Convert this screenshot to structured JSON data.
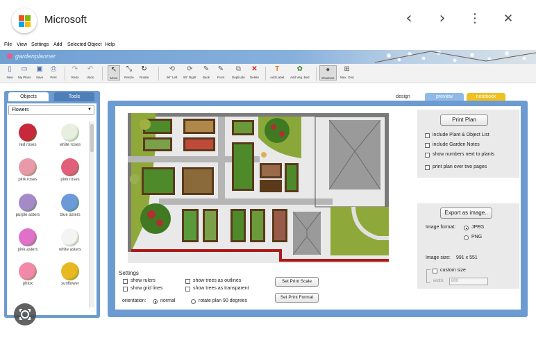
{
  "window": {
    "title": "Microsoft",
    "back_icon": "‹",
    "forward_icon": "›",
    "more_icon": "⋮",
    "close_icon": "✕"
  },
  "menu": [
    "File",
    "View",
    "Settings",
    "Add",
    "Selected Object",
    "Help"
  ],
  "brand": {
    "name": "gardenplanner"
  },
  "toolbar": [
    {
      "icon": "new-doc-icon",
      "label": "New"
    },
    {
      "icon": "folder-icon",
      "label": "My Plans"
    },
    {
      "icon": "save-icon",
      "label": "Save"
    },
    {
      "icon": "print-icon",
      "label": "Print"
    },
    {
      "icon": "redo-icon",
      "label": "Redo"
    },
    {
      "icon": "undo-icon",
      "label": "Undo"
    },
    {
      "icon": "cursor-icon",
      "label": "Move"
    },
    {
      "icon": "resize-icon",
      "label": "Resize"
    },
    {
      "icon": "rotate-icon",
      "label": "Rotate"
    },
    {
      "icon": "rotate-left-icon",
      "label": "90° Left"
    },
    {
      "icon": "rotate-right-icon",
      "label": "90° Right"
    },
    {
      "icon": "pen-icon",
      "label": "Back"
    },
    {
      "icon": "pen-front-icon",
      "label": "Front"
    },
    {
      "icon": "duplicate-icon",
      "label": "Duplicate"
    },
    {
      "icon": "delete-icon",
      "label": "Delete"
    },
    {
      "icon": "text-icon",
      "label": "Add Label"
    },
    {
      "icon": "veg-bed-icon",
      "label": "Add Veg. Bed"
    },
    {
      "icon": "shadow-icon",
      "label": "Shadows"
    },
    {
      "icon": "grid-icon",
      "label": "Max. Grid"
    }
  ],
  "left_panel": {
    "tabs": [
      "Objects",
      "Tools"
    ],
    "category": "Flowers",
    "plants": [
      {
        "name": "red roses",
        "color": "#c8283a"
      },
      {
        "name": "white roses",
        "color": "#e8efe0"
      },
      {
        "name": "pink roses",
        "color": "#e89aa8"
      },
      {
        "name": "pink roses",
        "color": "#e0607a"
      },
      {
        "name": "purple asters",
        "color": "#a58ac8"
      },
      {
        "name": "blue asters",
        "color": "#6c9ad8"
      },
      {
        "name": "pink asters",
        "color": "#e070c8"
      },
      {
        "name": "white asters",
        "color": "#f4f4f4"
      },
      {
        "name": "phlox",
        "color": "#f08aa8"
      },
      {
        "name": "sunflower",
        "color": "#e8b820"
      }
    ]
  },
  "view_tabs": [
    "design",
    "preview",
    "notebook"
  ],
  "print": {
    "button": "Print Plan",
    "options": [
      "include Plant & Object List",
      "include Garden Notes",
      "show numbers next to plants",
      "print plan over two pages"
    ]
  },
  "export": {
    "button": "Export as image..",
    "format_label": "Image format:",
    "formats": [
      "JPEG",
      "PNG"
    ],
    "selected_format": "JPEG",
    "size_label": "Image size:",
    "size_value": "991 x 551",
    "custom_size_label": "custom size",
    "width_label": "width:",
    "width_value": "800"
  },
  "settings": {
    "title": "Settings",
    "checks": [
      "show rulers",
      "show grid lines",
      "show trees as outlines",
      "show trees as transparent"
    ],
    "orientation_label": "orientation:",
    "orientation_options": [
      "normal",
      "rotate plan 90 degrees"
    ],
    "selected_orientation": "normal",
    "scale_button": "Set Print Scale",
    "format_button": "Set Print Format"
  }
}
